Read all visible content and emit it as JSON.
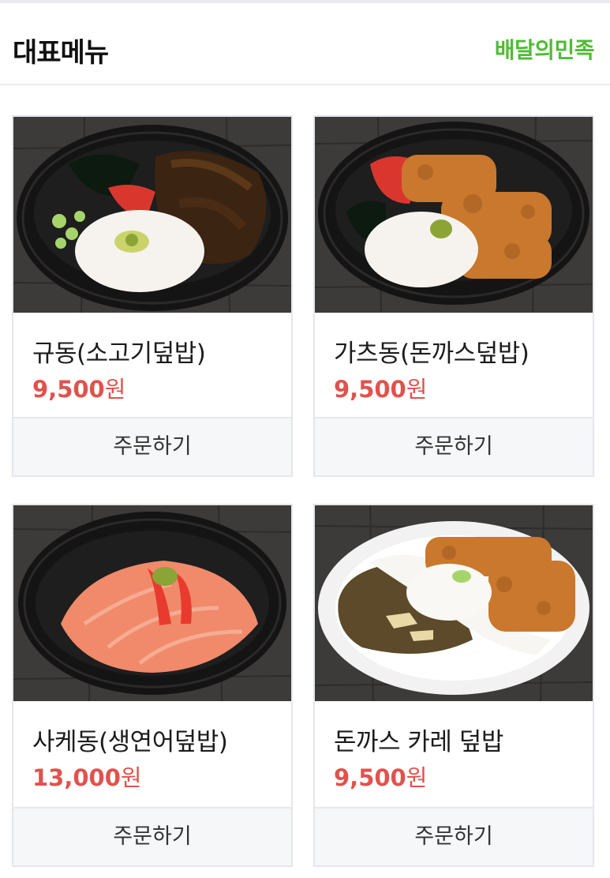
{
  "header": {
    "title": "대표메뉴",
    "brand": "배달의민족"
  },
  "menu": [
    {
      "name": "규동(소고기덮밥)",
      "price": "9,500",
      "currency": "원",
      "order_label": "주문하기",
      "photo": "gyudon-bowl-photo"
    },
    {
      "name": "가츠동(돈까스덮밥)",
      "price": "9,500",
      "currency": "원",
      "order_label": "주문하기",
      "photo": "katsudon-bowl-photo"
    },
    {
      "name": "사케동(생연어덮밥)",
      "price": "13,000",
      "currency": "원",
      "order_label": "주문하기",
      "photo": "sakedon-bowl-photo"
    },
    {
      "name": "돈까스 카레 덮밥",
      "price": "9,500",
      "currency": "원",
      "order_label": "주문하기",
      "photo": "katsu-curry-plate-photo"
    }
  ],
  "colors": {
    "brand_green": "#4fbc34",
    "price_red": "#e0524d"
  }
}
